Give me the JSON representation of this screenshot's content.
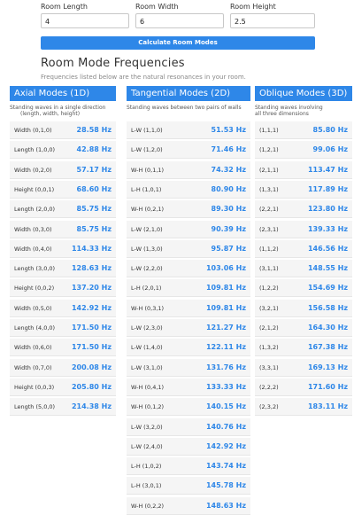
{
  "form": {
    "length_label": "Room Length",
    "length_value": "4",
    "width_label": "Room Width",
    "width_value": "6",
    "height_label": "Room Height",
    "height_value": "2.5",
    "calculate_label": "Calculate Room Modes"
  },
  "results": {
    "title": "Room Mode Frequencies",
    "subtitle": "Frequencies listed below are the natural resonances in your room."
  },
  "axial": {
    "heading": "Axial Modes (1D)",
    "desc_line1": "Standing waves in a single direction",
    "desc_line2": "(length, width, height)",
    "rows": [
      {
        "mode": "Width (0,1,0)",
        "freq": "28.58 Hz"
      },
      {
        "mode": "Length (1,0,0)",
        "freq": "42.88 Hz"
      },
      {
        "mode": "Width (0,2,0)",
        "freq": "57.17 Hz"
      },
      {
        "mode": "Height (0,0,1)",
        "freq": "68.60 Hz"
      },
      {
        "mode": "Length (2,0,0)",
        "freq": "85.75 Hz"
      },
      {
        "mode": "Width (0,3,0)",
        "freq": "85.75 Hz"
      },
      {
        "mode": "Width (0,4,0)",
        "freq": "114.33 Hz"
      },
      {
        "mode": "Length (3,0,0)",
        "freq": "128.63 Hz"
      },
      {
        "mode": "Height (0,0,2)",
        "freq": "137.20 Hz"
      },
      {
        "mode": "Width (0,5,0)",
        "freq": "142.92 Hz"
      },
      {
        "mode": "Length (4,0,0)",
        "freq": "171.50 Hz"
      },
      {
        "mode": "Width (0,6,0)",
        "freq": "171.50 Hz"
      },
      {
        "mode": "Width (0,7,0)",
        "freq": "200.08 Hz"
      },
      {
        "mode": "Height (0,0,3)",
        "freq": "205.80 Hz"
      },
      {
        "mode": "Length (5,0,0)",
        "freq": "214.38 Hz"
      }
    ]
  },
  "tangential": {
    "heading": "Tangential Modes (2D)",
    "desc_line1": "Standing waves between two pairs of walls",
    "rows": [
      {
        "mode": "L-W (1,1,0)",
        "freq": "51.53 Hz"
      },
      {
        "mode": "L-W (1,2,0)",
        "freq": "71.46 Hz"
      },
      {
        "mode": "W-H (0,1,1)",
        "freq": "74.32 Hz"
      },
      {
        "mode": "L-H (1,0,1)",
        "freq": "80.90 Hz"
      },
      {
        "mode": "W-H (0,2,1)",
        "freq": "89.30 Hz"
      },
      {
        "mode": "L-W (2,1,0)",
        "freq": "90.39 Hz"
      },
      {
        "mode": "L-W (1,3,0)",
        "freq": "95.87 Hz"
      },
      {
        "mode": "L-W (2,2,0)",
        "freq": "103.06 Hz"
      },
      {
        "mode": "L-H (2,0,1)",
        "freq": "109.81 Hz"
      },
      {
        "mode": "W-H (0,3,1)",
        "freq": "109.81 Hz"
      },
      {
        "mode": "L-W (2,3,0)",
        "freq": "121.27 Hz"
      },
      {
        "mode": "L-W (1,4,0)",
        "freq": "122.11 Hz"
      },
      {
        "mode": "L-W (3,1,0)",
        "freq": "131.76 Hz"
      },
      {
        "mode": "W-H (0,4,1)",
        "freq": "133.33 Hz"
      },
      {
        "mode": "W-H (0,1,2)",
        "freq": "140.15 Hz"
      },
      {
        "mode": "L-W (3,2,0)",
        "freq": "140.76 Hz"
      },
      {
        "mode": "L-W (2,4,0)",
        "freq": "142.92 Hz"
      },
      {
        "mode": "L-H (1,0,2)",
        "freq": "143.74 Hz"
      },
      {
        "mode": "L-H (3,0,1)",
        "freq": "145.78 Hz"
      },
      {
        "mode": "W-H (0,2,2)",
        "freq": "148.63 Hz"
      }
    ]
  },
  "oblique": {
    "heading": "Oblique Modes (3D)",
    "desc_line1": "Standing waves involving",
    "desc_line2": "all three dimensions",
    "rows": [
      {
        "mode": "(1,1,1)",
        "freq": "85.80 Hz"
      },
      {
        "mode": "(1,2,1)",
        "freq": "99.06 Hz"
      },
      {
        "mode": "(2,1,1)",
        "freq": "113.47 Hz"
      },
      {
        "mode": "(1,3,1)",
        "freq": "117.89 Hz"
      },
      {
        "mode": "(2,2,1)",
        "freq": "123.80 Hz"
      },
      {
        "mode": "(2,3,1)",
        "freq": "139.33 Hz"
      },
      {
        "mode": "(1,1,2)",
        "freq": "146.56 Hz"
      },
      {
        "mode": "(3,1,1)",
        "freq": "148.55 Hz"
      },
      {
        "mode": "(1,2,2)",
        "freq": "154.69 Hz"
      },
      {
        "mode": "(3,2,1)",
        "freq": "156.58 Hz"
      },
      {
        "mode": "(2,1,2)",
        "freq": "164.30 Hz"
      },
      {
        "mode": "(1,3,2)",
        "freq": "167.38 Hz"
      },
      {
        "mode": "(3,3,1)",
        "freq": "169.13 Hz"
      },
      {
        "mode": "(2,2,2)",
        "freq": "171.60 Hz"
      },
      {
        "mode": "(2,3,2)",
        "freq": "183.11 Hz"
      }
    ]
  }
}
